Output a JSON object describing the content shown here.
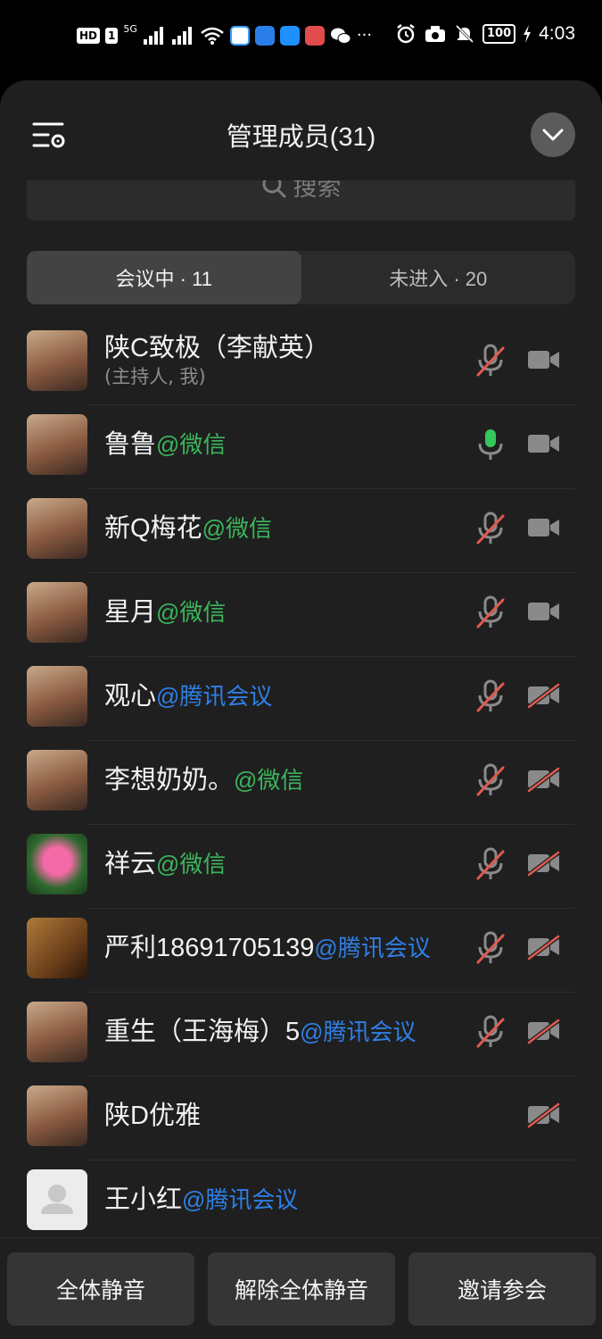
{
  "status_bar": {
    "hd_tag": "HD",
    "sim_tag": "1",
    "net_label": "5G",
    "battery": "100",
    "time": "4:03",
    "icons": [
      "signal-icon",
      "wifi-icon",
      "app-icon",
      "alarm-icon",
      "camera-icon",
      "bell-off-icon",
      "charging-icon",
      "more-icon"
    ]
  },
  "header": {
    "title": "管理成员(31)",
    "settings_icon": "list-settings-icon",
    "collapse_icon": "chevron-down-icon"
  },
  "search": {
    "placeholder": "搜索",
    "icon": "search-icon"
  },
  "tabs": [
    {
      "label": "会议中 · 11",
      "active": true
    },
    {
      "label": "未进入 · 20",
      "active": false
    }
  ],
  "members": [
    {
      "name": "陕C致极（李献英）",
      "source": "",
      "role": "(主持人, 我)",
      "mic": "muted",
      "cam": "off-gray",
      "avatar": "photo"
    },
    {
      "name": "鲁鲁",
      "source": "@微信",
      "mic": "on",
      "cam": "off-gray",
      "avatar": "photo"
    },
    {
      "name": "新Q梅花",
      "source": "@微信",
      "mic": "muted",
      "cam": "off-gray",
      "avatar": "photo"
    },
    {
      "name": "星月",
      "source": "@微信",
      "mic": "muted",
      "cam": "off-gray",
      "avatar": "photo"
    },
    {
      "name": "观心",
      "source": "@腾讯会议",
      "mic": "muted",
      "cam": "disabled",
      "avatar": "photo"
    },
    {
      "name": "李想奶奶。",
      "source": "@微信",
      "mic": "muted",
      "cam": "disabled",
      "avatar": "photo"
    },
    {
      "name": "祥云",
      "source": "@微信",
      "mic": "muted",
      "cam": "disabled",
      "avatar": "lotus"
    },
    {
      "name": "严利18691705139",
      "source": "@腾讯会议",
      "mic": "muted",
      "cam": "disabled",
      "avatar": "chess"
    },
    {
      "name": "重生（王海梅）5",
      "source": "@腾讯会议",
      "mic": "muted",
      "cam": "disabled",
      "avatar": "photo"
    },
    {
      "name": "陕D优雅",
      "source": "",
      "mic": "none",
      "cam": "disabled",
      "avatar": "photo"
    },
    {
      "name": "王小红",
      "source": "@腾讯会议",
      "mic": "none",
      "cam": "none",
      "avatar": "default"
    }
  ],
  "bottom_buttons": {
    "mute_all": "全体静音",
    "unmute_all": "解除全体静音",
    "invite": "邀请参会"
  },
  "colors": {
    "background": "#1f1f1f",
    "wechat_green": "#3cb55c",
    "tencent_blue": "#2f7fe6",
    "muted_red": "#e05a4f",
    "mic_on_green": "#34c759"
  }
}
